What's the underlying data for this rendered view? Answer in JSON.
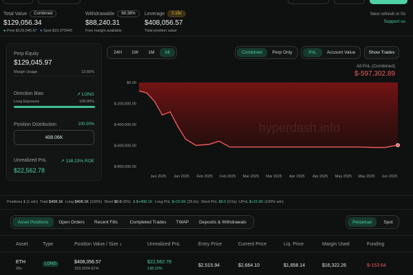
{
  "top_bar": {
    "buttons_partial": [
      "",
      "",
      "",
      "",
      ""
    ]
  },
  "summary": {
    "total_value": {
      "label": "Total Value",
      "badge": "Combined",
      "value": "$129,056.34",
      "perp_label": "Perp",
      "perp_value": "$129,045.97",
      "spot_label": "Spot",
      "spot_value": "$10.370945"
    },
    "withdrawable": {
      "label": "Withdrawable",
      "badge": "68.38%",
      "value": "$88,240.31",
      "sub": "Free margin available"
    },
    "leverage": {
      "label": "Leverage",
      "badge": "3.18x",
      "value": "$408,056.57",
      "sub": "Total position value"
    },
    "refresh": "Next refresh in 0s",
    "support": "Support us"
  },
  "left_panel": {
    "perp_equity_label": "Perp Equity",
    "perp_equity_value": "$129,045.97",
    "margin_usage_label": "Margin Usage",
    "margin_usage_value": "12.65%",
    "margin_usage_fraction": 0.1265,
    "direction_bias_label": "Direction Bias",
    "direction_bias_value": "LONG",
    "long_exposure_label": "Long Exposure",
    "long_exposure_value": "100.00%",
    "long_exposure_fraction": 1.0,
    "position_distribution_label": "Position Distribution",
    "position_distribution_value": "100.00%",
    "position_distribution_box": "408.06K",
    "unrealized_pnl_label": "Unrealized PnL",
    "unrealized_pnl_roe": "138.23% ROE",
    "unrealized_pnl_value": "$22,562.78"
  },
  "chart_controls": {
    "ranges": [
      "24H",
      "1W",
      "1M",
      "All"
    ],
    "active_range": "All",
    "modes": [
      "Combined",
      "Perp Only"
    ],
    "active_mode": "Combined",
    "metrics": [
      "PnL",
      "Account Value"
    ],
    "active_metric": "PnL",
    "show_trades": "Show Trades",
    "pnl_label": "All PnL (Combined)",
    "pnl_value": "$-597,302.89",
    "watermark": "hyperdash.info"
  },
  "chart_data": {
    "type": "area",
    "ylabel": "",
    "xlabel": "",
    "y_ticks": [
      "$0.00",
      "$-200,000.00",
      "$-400,000.00",
      "$-600,000.00",
      "$-800,000.00"
    ],
    "ylim": [
      -800000,
      0
    ],
    "x_ticks": [
      "Jan 2025",
      "Jan 2025",
      "Feb 2025",
      "Feb 2025",
      "Mar 2025",
      "Mar 2025",
      "Apr 2025",
      "Apr 2025",
      "May 2025",
      "May 2025",
      "Jun 2025"
    ],
    "x": [
      0,
      0.03,
      0.06,
      0.09,
      0.12,
      0.15,
      0.18,
      0.22,
      0.27,
      0.31,
      0.35,
      0.4,
      0.5,
      0.6,
      0.7,
      0.8,
      0.85,
      0.9,
      0.95,
      1.0
    ],
    "values": [
      -80000,
      -100000,
      -180000,
      -310000,
      -280000,
      -420000,
      -540000,
      -600000,
      -590000,
      -560000,
      -615000,
      -615000,
      -615000,
      -615000,
      -615000,
      -615000,
      -615000,
      -620000,
      -620000,
      -597303
    ],
    "color": "#f05a5a"
  },
  "stats_row": {
    "positions_label": "Positions",
    "positions_value": "1",
    "positions_sub": "(1 win)",
    "total_label": "Total",
    "total_value": "$408.1K",
    "long_label": "Long",
    "long_value": "$408.1K",
    "long_sub": "(100%)",
    "short_label": "Short",
    "short_value": "$0.0",
    "short_sub": "(0%)",
    "delta_label": "Δ",
    "delta_value": "$+408.1K",
    "long_pnl_label": "Long PnL",
    "long_pnl_value": "$+22.6K",
    "long_pnl_sub": "(25.0x)",
    "short_pnl_label": "Short PnL",
    "short_pnl_value": "$0.0",
    "short_pnl_sub": "(0.0x)",
    "upnl_label": "UPnL",
    "upnl_value": "$+22.6K",
    "upnl_sub": "(100% win)"
  },
  "bottom_tabs": {
    "tabs": [
      "Asset Positions",
      "Open Orders",
      "Recent Fills",
      "Completed Trades",
      "TWAP",
      "Deposits & Withdrawals"
    ],
    "active": "Asset Positions",
    "right_tabs": [
      "Perpetual",
      "Spot"
    ],
    "right_active": "Perpetual"
  },
  "table": {
    "headers": [
      "Asset",
      "Type",
      "Position Value / Size",
      "Unrealized PnL",
      "Entry Price",
      "Current Price",
      "Liq. Price",
      "Margin Used",
      "Funding"
    ],
    "sort_arrow": "↓",
    "row": {
      "asset": "ETH",
      "leverage": "25x",
      "type": "LONG",
      "value": "$408,056.57",
      "size": "153.2204 ETH",
      "pnl": "$22,562.78",
      "pnl_pct": "138.23%",
      "entry": "$2,515.94",
      "current": "$2,664.10",
      "liq": "$1,858.14",
      "margin": "$16,322.26",
      "funding": "$-153.64"
    }
  },
  "colors": {
    "accent": "#4fd1a5",
    "negative": "#f05a5a",
    "background": "#0e1110"
  }
}
